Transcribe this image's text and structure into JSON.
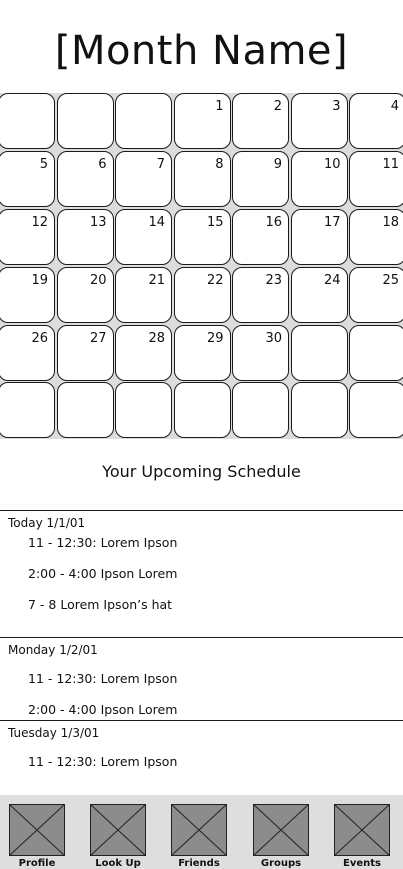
{
  "header": {
    "month_title": "[Month Name]"
  },
  "calendar": {
    "days": [
      "",
      "",
      "",
      "1",
      "2",
      "3",
      "4",
      "5",
      "6",
      "7",
      "8",
      "9",
      "10",
      "11",
      "12",
      "13",
      "14",
      "15",
      "16",
      "17",
      "18",
      "19",
      "20",
      "21",
      "22",
      "23",
      "24",
      "25",
      "26",
      "27",
      "28",
      "29",
      "30",
      "",
      "",
      "",
      "",
      "",
      "",
      "",
      "",
      ""
    ]
  },
  "schedule": {
    "title": "Your Upcoming Schedule",
    "days": [
      {
        "label": "Today 1/1/01",
        "events": [
          "11 - 12:30: Lorem Ipson",
          "2:00 - 4:00 Ipson Lorem",
          "7 - 8 Lorem Ipson’s hat"
        ]
      },
      {
        "label": "Monday 1/2/01",
        "events": [
          "11 - 12:30: Lorem Ipson",
          "2:00 - 4:00 Ipson Lorem"
        ]
      },
      {
        "label": "Tuesday 1/3/01",
        "events": [
          "11 - 12:30: Lorem Ipson"
        ]
      }
    ]
  },
  "tabs": [
    {
      "label": "Profile",
      "icon": "image-placeholder-icon"
    },
    {
      "label": "Look Up",
      "icon": "image-placeholder-icon"
    },
    {
      "label": "Friends",
      "icon": "image-placeholder-icon"
    },
    {
      "label": "Groups",
      "icon": "image-placeholder-icon"
    },
    {
      "label": "Events",
      "icon": "image-placeholder-icon"
    }
  ],
  "colors": {
    "placeholder_fill": "#8c8c8c",
    "tabbar_bg": "#dedede",
    "grid_bg": "#dcdcdc"
  }
}
